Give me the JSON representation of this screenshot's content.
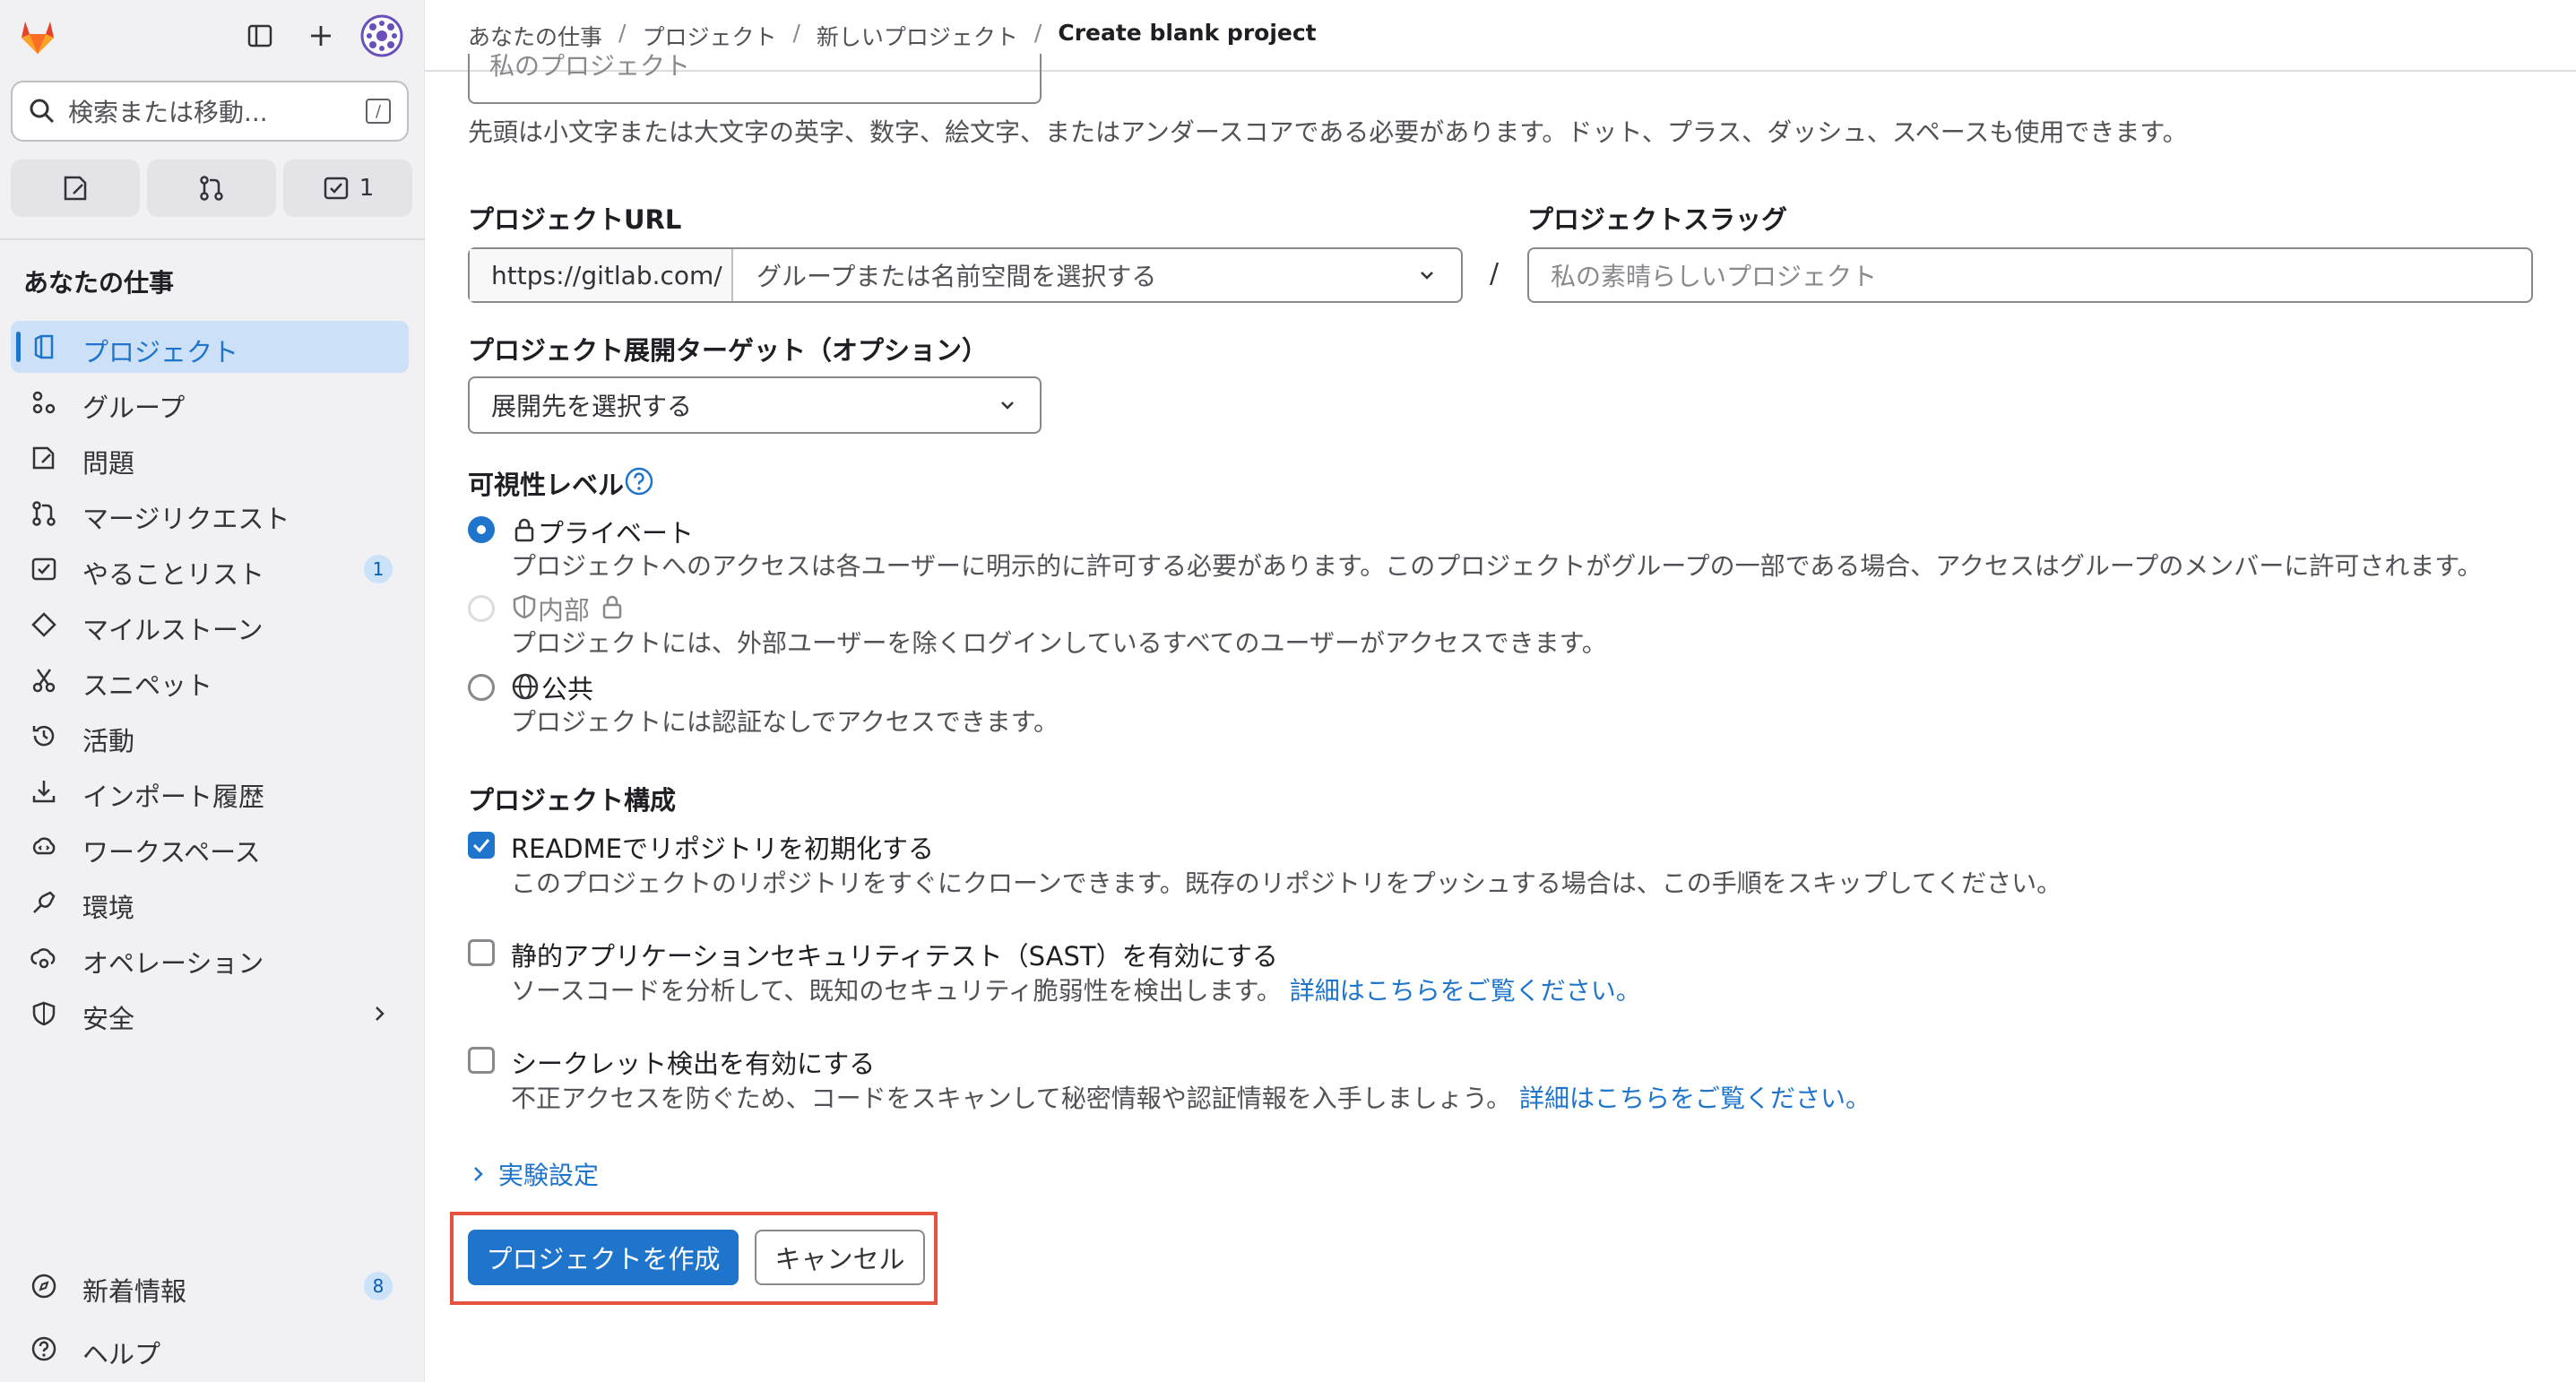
{
  "breadcrumb": [
    "あなたの仕事",
    "プロジェクト",
    "新しいプロジェクト",
    "Create blank project"
  ],
  "sidebar": {
    "search_placeholder": "検索または移動...",
    "search_shortcut": "/",
    "quick": {
      "todo_count": "1"
    },
    "section_title": "あなたの仕事",
    "items": [
      {
        "label": "プロジェクト",
        "icon": "project-icon"
      },
      {
        "label": "グループ",
        "icon": "group-icon"
      },
      {
        "label": "問題",
        "icon": "issues-icon"
      },
      {
        "label": "マージリクエスト",
        "icon": "merge-request-icon"
      },
      {
        "label": "やることリスト",
        "icon": "todo-icon",
        "badge": "1"
      },
      {
        "label": "マイルストーン",
        "icon": "milestone-icon"
      },
      {
        "label": "スニペット",
        "icon": "snippet-icon"
      },
      {
        "label": "活動",
        "icon": "history-icon"
      },
      {
        "label": "インポート履歴",
        "icon": "import-icon"
      },
      {
        "label": "ワークスペース",
        "icon": "workspace-icon"
      },
      {
        "label": "環境",
        "icon": "environment-icon"
      },
      {
        "label": "オペレーション",
        "icon": "operations-icon"
      },
      {
        "label": "安全",
        "icon": "security-icon"
      }
    ],
    "bottom": [
      {
        "label": "新着情報",
        "badge": "8"
      },
      {
        "label": "ヘルプ"
      }
    ]
  },
  "form": {
    "project_name_placeholder": "私のプロジェクト",
    "name_help": "先頭は小文字または大文字の英字、数字、絵文字、またはアンダースコアである必要があります。ドット、プラス、ダッシュ、スペースも使用できます。",
    "url_label": "プロジェクトURL",
    "url_prefix": "https://gitlab.com/",
    "namespace_placeholder": "グループまたは名前空間を選択する",
    "slash": "/",
    "slug_label": "プロジェクトスラッグ",
    "slug_placeholder": "私の素晴らしいプロジェクト",
    "deploy_label": "プロジェクト展開ターゲット（オプション）",
    "deploy_placeholder": "展開先を選択する",
    "visibility_label": "可視性レベル",
    "visibility": [
      {
        "title": "プライベート",
        "desc": "プロジェクトへのアクセスは各ユーザーに明示的に許可する必要があります。このプロジェクトがグループの一部である場合、アクセスはグループのメンバーに許可されます。",
        "checked": true
      },
      {
        "title": "内部",
        "desc": "プロジェクトには、外部ユーザーを除くログインしているすべてのユーザーがアクセスできます。",
        "disabled": true
      },
      {
        "title": "公共",
        "desc": "プロジェクトには認証なしでアクセスできます。"
      }
    ],
    "config_label": "プロジェクト構成",
    "config": [
      {
        "title": "READMEでリポジトリを初期化する",
        "desc": "このプロジェクトのリポジトリをすぐにクローンできます。既存のリポジトリをプッシュする場合は、この手順をスキップしてください。",
        "checked": true
      },
      {
        "title": "静的アプリケーションセキュリティテスト（SAST）を有効にする",
        "desc": "ソースコードを分析して、既知のセキュリティ脆弱性を検出します。",
        "link": "詳細はこちらをご覧ください。"
      },
      {
        "title": "シークレット検出を有効にする",
        "desc": "不正アクセスを防ぐため、コードをスキャンして秘密情報や認証情報を入手しましょう。",
        "link": "詳細はこちらをご覧ください。"
      }
    ],
    "experimental": "実験設定",
    "create_button": "プロジェクトを作成",
    "cancel_button": "キャンセル"
  },
  "colors": {
    "accent": "#1f75cb",
    "highlight": "#e5523e",
    "sidebar_bg": "#f1f1f3"
  }
}
